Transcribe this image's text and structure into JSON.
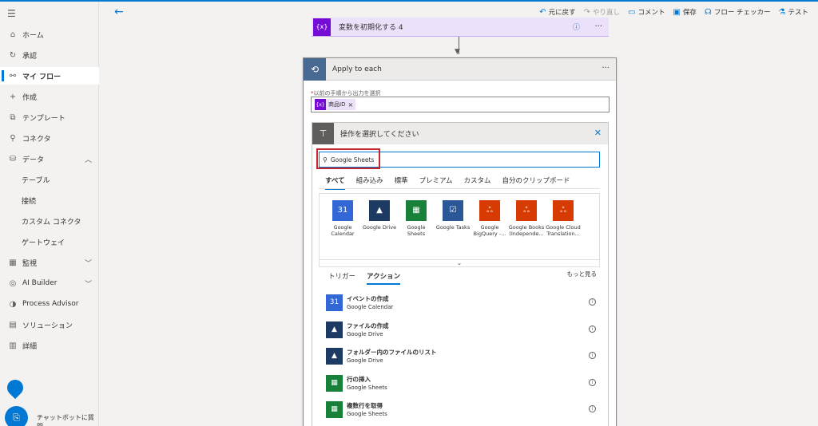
{
  "sidebar": {
    "items": [
      {
        "label": "ホーム",
        "icon": "home-icon",
        "glyph": "⌂"
      },
      {
        "label": "承認",
        "icon": "approval-icon",
        "glyph": "↻"
      },
      {
        "label": "マイ フロー",
        "icon": "flow-icon",
        "glyph": "⚯"
      },
      {
        "label": "作成",
        "icon": "plus-icon",
        "glyph": "+"
      },
      {
        "label": "テンプレート",
        "icon": "template-icon",
        "glyph": "⧉"
      },
      {
        "label": "コネクタ",
        "icon": "connector-icon",
        "glyph": "⚲"
      },
      {
        "label": "データ",
        "icon": "data-icon",
        "glyph": "⛁"
      },
      {
        "label": "テーブル"
      },
      {
        "label": "接続"
      },
      {
        "label": "カスタム コネクタ"
      },
      {
        "label": "ゲートウェイ"
      },
      {
        "label": "監視",
        "icon": "monitor-icon",
        "glyph": "▦"
      },
      {
        "label": "AI Builder",
        "icon": "ai-builder-icon",
        "glyph": "◎"
      },
      {
        "label": "Process Advisor",
        "icon": "process-advisor-icon",
        "glyph": "◑"
      },
      {
        "label": "ソリューション",
        "icon": "solution-icon",
        "glyph": "▤"
      },
      {
        "label": "詳細",
        "icon": "book-icon",
        "glyph": "▥"
      }
    ],
    "chatbot_label": "チャットボットに質問"
  },
  "toolbar": {
    "undo": "元に戻す",
    "redo": "やり直し",
    "comment": "コメント",
    "save": "保存",
    "flow_checker": "フロー チェッカー",
    "test": "テスト"
  },
  "init_variable": {
    "icon_text": "{x}",
    "title": "変数を初期化する 4"
  },
  "apply_each": {
    "title": "Apply to each",
    "field_label": "以前の手順から出力を選択",
    "token_icon": "{x}",
    "token_label": "商品ID"
  },
  "operation": {
    "title": "操作を選択してください",
    "search_value": "Google Sheets",
    "tabs": [
      "すべて",
      "組み込み",
      "標準",
      "プレミアム",
      "カスタム",
      "自分のクリップボード"
    ],
    "connectors": [
      {
        "name": "Google Calendar",
        "label1": "Google",
        "label2": "Calendar",
        "glyph": "31",
        "color": "#3367d6",
        "icon": "google-calendar-icon"
      },
      {
        "name": "Google Drive",
        "label1": "Google Drive",
        "label2": "",
        "glyph": "▲",
        "color": "#1d3a62",
        "icon": "google-drive-icon"
      },
      {
        "name": "Google Sheets",
        "label1": "Google",
        "label2": "Sheets",
        "glyph": "▦",
        "color": "#188038",
        "icon": "google-sheets-icon"
      },
      {
        "name": "Google Tasks",
        "label1": "Google Tasks",
        "label2": "",
        "glyph": "☑",
        "color": "#2b5797",
        "icon": "google-tasks-icon"
      },
      {
        "name": "Google BigQuery",
        "label1": "Google",
        "label2": "BigQuery -...",
        "glyph": "ஃ",
        "color": "#d83b01",
        "icon": "google-bigquery-icon"
      },
      {
        "name": "Google Books",
        "label1": "Google Books",
        "label2": "(Independe...",
        "glyph": "ஃ",
        "color": "#d83b01",
        "icon": "google-books-icon"
      },
      {
        "name": "Google Cloud Translation",
        "label1": "Google Cloud",
        "label2": "Translation...",
        "glyph": "ஃ",
        "color": "#d83b01",
        "icon": "google-translation-icon"
      }
    ],
    "subtabs": [
      "トリガー",
      "アクション"
    ],
    "more_link": "もっと見る",
    "actions": [
      {
        "title": "イベントの作成",
        "connector": "Google Calendar",
        "glyph": "31",
        "color": "#3367d6"
      },
      {
        "title": "ファイルの作成",
        "connector": "Google Drive",
        "glyph": "▲",
        "color": "#1d3a62"
      },
      {
        "title": "フォルダー内のファイルのリスト",
        "connector": "Google Drive",
        "glyph": "▲",
        "color": "#1d3a62"
      },
      {
        "title": "行の挿入",
        "connector": "Google Sheets",
        "glyph": "▦",
        "color": "#188038"
      },
      {
        "title": "複数行を取得",
        "connector": "Google Sheets",
        "glyph": "▦",
        "color": "#188038"
      }
    ]
  }
}
